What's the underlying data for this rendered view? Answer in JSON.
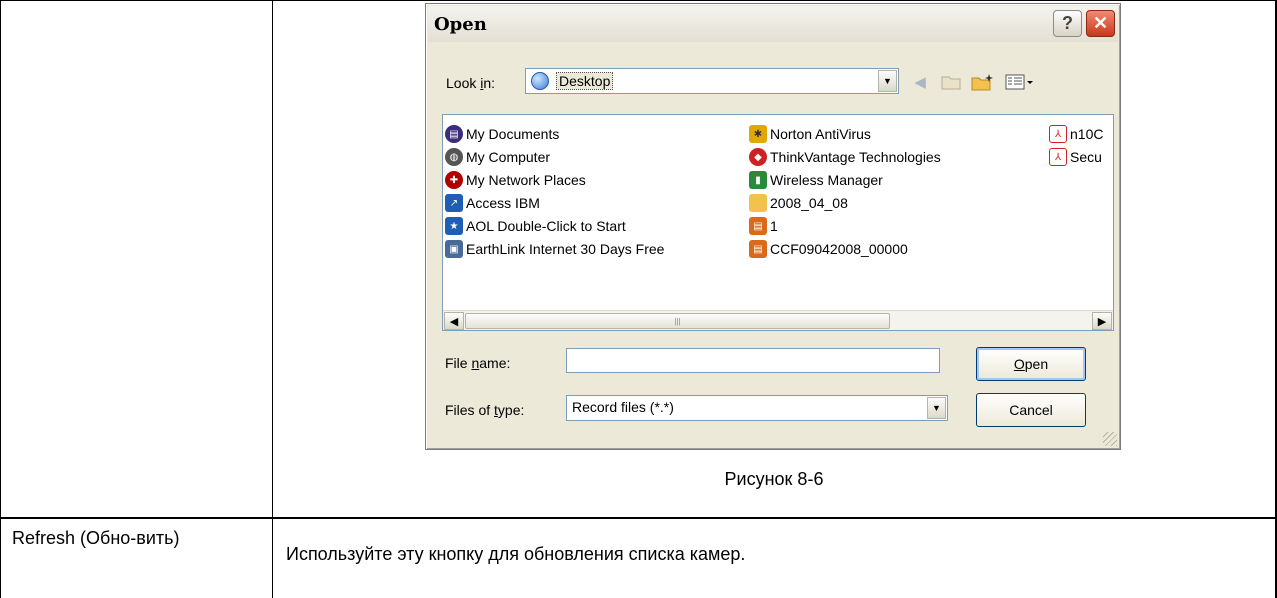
{
  "dialog": {
    "title": "Open",
    "help_symbol": "?",
    "close_symbol": "✕",
    "look_in": {
      "label_pre": "Look ",
      "label_key": "i",
      "label_post": "n:",
      "value": "Desktop"
    },
    "files": [
      {
        "name": "My Documents",
        "icon": "my-documents-icon",
        "color": "#3b2b7a"
      },
      {
        "name": "My Computer",
        "icon": "my-computer-icon",
        "color": "#555555"
      },
      {
        "name": "My Network Places",
        "icon": "network-places-icon",
        "color": "#b00000"
      },
      {
        "name": "Access IBM",
        "icon": "access-ibm-icon",
        "color": "#1e5fb3"
      },
      {
        "name": "AOL Double-Click to Start",
        "icon": "aol-icon",
        "color": "#1e5fb3"
      },
      {
        "name": "EarthLink Internet 30 Days Free",
        "icon": "earthlink-icon",
        "color": "#4a6a9a"
      },
      {
        "name": "Norton AntiVirus",
        "icon": "norton-icon",
        "color": "#e0a800"
      },
      {
        "name": "ThinkVantage Technologies",
        "icon": "thinkvantage-icon",
        "color": "#cc2222"
      },
      {
        "name": "Wireless Manager",
        "icon": "wireless-manager-icon",
        "color": "#2a8a3a"
      },
      {
        "name": "2008_04_08",
        "icon": "folder-icon",
        "color": "#f2c14e"
      },
      {
        "name": "1",
        "icon": "record-file-icon",
        "color": "#d96a1a"
      },
      {
        "name": "CCF09042008_00000",
        "icon": "record-file-icon",
        "color": "#d96a1a"
      },
      {
        "name": "n10C",
        "icon": "pdf-icon",
        "color": "#d42020"
      },
      {
        "name": "Secu",
        "icon": "pdf-icon",
        "color": "#d42020"
      }
    ],
    "file_name": {
      "label_pre": "File ",
      "label_key": "n",
      "label_post": "ame:",
      "value": ""
    },
    "files_of_type": {
      "label_pre": "Files of ",
      "label_key": "t",
      "label_post": "ype:",
      "value": "Record files (*.*)"
    },
    "open_button": {
      "key": "O",
      "rest": "pen"
    },
    "cancel_button": "Cancel"
  },
  "caption": "Рисунок 8-6",
  "table": {
    "row_label": "Refresh (Обно-вить)",
    "row_description": "Используйте эту кнопку для обновления списка камер."
  }
}
